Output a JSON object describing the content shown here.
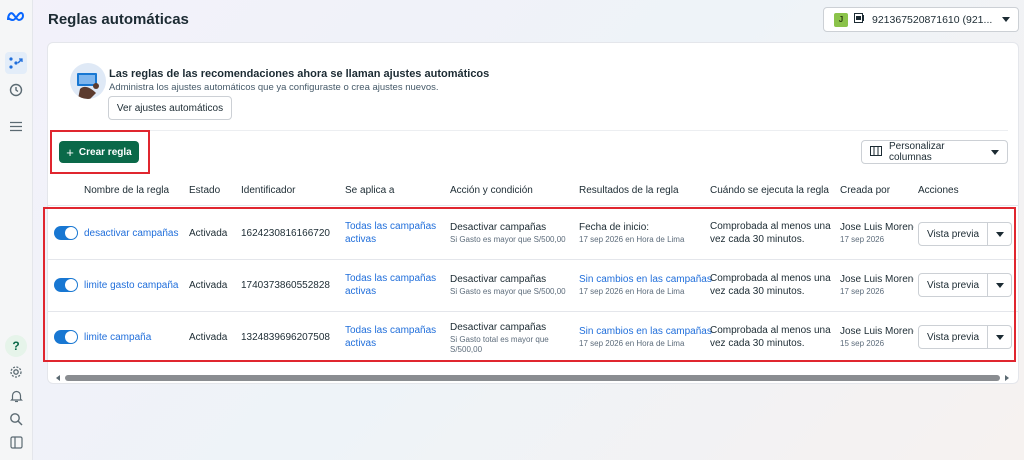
{
  "app": {
    "title": "Reglas automáticas"
  },
  "account": {
    "avatar_letter": "J",
    "label": "921367520871610 (921..."
  },
  "rail": {
    "icons": [
      "meta-logo-icon",
      "rules-icon",
      "history-icon",
      "menu-icon",
      "help-icon",
      "settings-icon",
      "bell-icon",
      "search-icon",
      "panel-toggle-icon"
    ],
    "help_label": "?"
  },
  "banner": {
    "title": "Las reglas de las recomendaciones ahora se llaman ajustes automáticos",
    "subtitle": "Administra los ajustes automáticos que ya configuraste o crea ajustes nuevos.",
    "button": "Ver ajustes automáticos"
  },
  "toolbar": {
    "create_label": "Crear regla",
    "create_icon": "+",
    "columns_label": "Personalizar columnas"
  },
  "table": {
    "headers": [
      "Nombre de la regla",
      "Estado",
      "Identificador",
      "Se aplica a",
      "Acción y condición",
      "Resultados de la regla",
      "Cuándo se ejecuta la regla",
      "Creada por",
      "Acciones"
    ],
    "rows": [
      {
        "name": "desactivar campañas",
        "status": "Activada",
        "id": "1624230816166720",
        "applies_1": "Todas las campañas",
        "applies_2": "activas",
        "action": "Desactivar campañas",
        "condition_1": "Si Gasto es mayor que S/500,00",
        "condition_2": "",
        "result": "Fecha de inicio:",
        "result_date": "17 sep 2026 en Hora de Lima",
        "when_1": "Comprobada al menos una",
        "when_2": "vez cada 30 minutos.",
        "creator": "Jose Luis Morenc",
        "created": "17 sep 2026",
        "preview": "Vista previa"
      },
      {
        "name": "limite gasto campaña",
        "status": "Activada",
        "id": "1740373860552828",
        "applies_1": "Todas las campañas",
        "applies_2": "activas",
        "action": "Desactivar campañas",
        "condition_1": "Si Gasto es mayor que S/500,00",
        "condition_2": "",
        "result": "Sin cambios en las campañas",
        "result_date": "17 sep 2026 en Hora de Lima",
        "when_1": "Comprobada al menos una",
        "when_2": "vez cada 30 minutos.",
        "creator": "Jose Luis Morenc",
        "created": "17 sep 2026",
        "preview": "Vista previa"
      },
      {
        "name": "limite campaña",
        "status": "Activada",
        "id": "1324839696207508",
        "applies_1": "Todas las campañas",
        "applies_2": "activas",
        "action": "Desactivar campañas",
        "condition_1": "Si Gasto total es mayor que",
        "condition_2": "S/500,00",
        "result": "Sin cambios en las campañas",
        "result_date": "17 sep 2026 en Hora de Lima",
        "when_1": "Comprobada al menos una",
        "when_2": "vez cada 30 minutos.",
        "creator": "Jose Luis Morenc",
        "created": "15 sep 2026",
        "preview": "Vista previa"
      }
    ]
  },
  "colors": {
    "primary": "#0a6949",
    "link": "#216fdb",
    "toggle": "#1877d2",
    "highlight": "#e0262f"
  }
}
